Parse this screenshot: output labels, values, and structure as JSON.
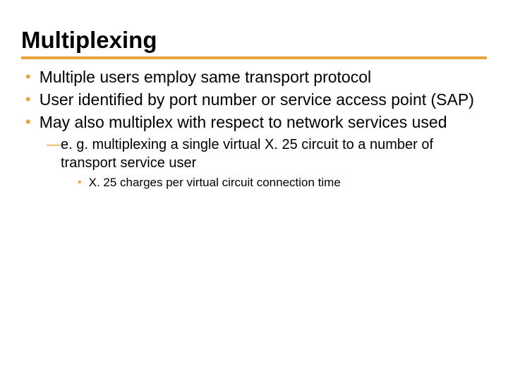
{
  "title": "Multiplexing",
  "bullets": {
    "b1": "Multiple users employ same transport protocol",
    "b2": "User identified by port number or service access point (SAP)",
    "b3": "May also multiplex with respect to network services used",
    "b3_sub1": "e. g. multiplexing a single virtual X. 25 circuit to a number of transport service user",
    "b3_sub1_sub1": "X. 25 charges per virtual circuit connection time"
  },
  "colors": {
    "accent": "#e8a33d"
  }
}
